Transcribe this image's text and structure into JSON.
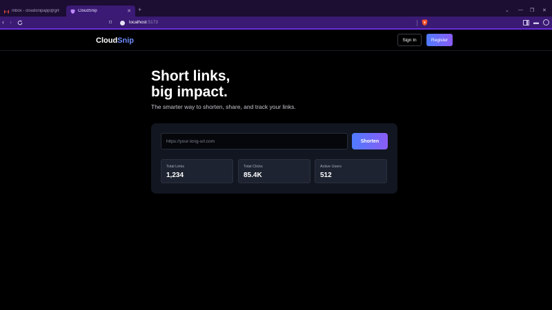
{
  "browser": {
    "tabs": [
      {
        "label": "Inbox - cloudsnipapp@gmail.com",
        "favicon": "gmail-icon",
        "active": false
      },
      {
        "label": "CloudSnip",
        "favicon": "brave-favicon",
        "active": true
      }
    ],
    "new_tab_glyph": "+",
    "address": {
      "host": "localhost",
      "port": ":5173"
    },
    "accent": "#3b1a75"
  },
  "nav": {
    "logo_part1": "Cloud",
    "logo_part2": "Snip",
    "signin_label": "Sign In",
    "register_label": "Register"
  },
  "hero": {
    "title_line1": "Short links,",
    "title_line2": "big impact.",
    "subtitle": "The smarter way to shorten, share, and track your links."
  },
  "shortener": {
    "placeholder": "https://your-long-url.com",
    "value": "",
    "button_label": "Shorten"
  },
  "stats": [
    {
      "label": "Total Links",
      "value": "1,234"
    },
    {
      "label": "Total Clicks",
      "value": "85.4K"
    },
    {
      "label": "Active Users",
      "value": "512"
    }
  ],
  "colors": {
    "brand_blue": "#6d8cff",
    "gradient_start": "#4f7bff",
    "gradient_end": "#8a5cf5",
    "background": "#000000",
    "card": "#111620"
  }
}
